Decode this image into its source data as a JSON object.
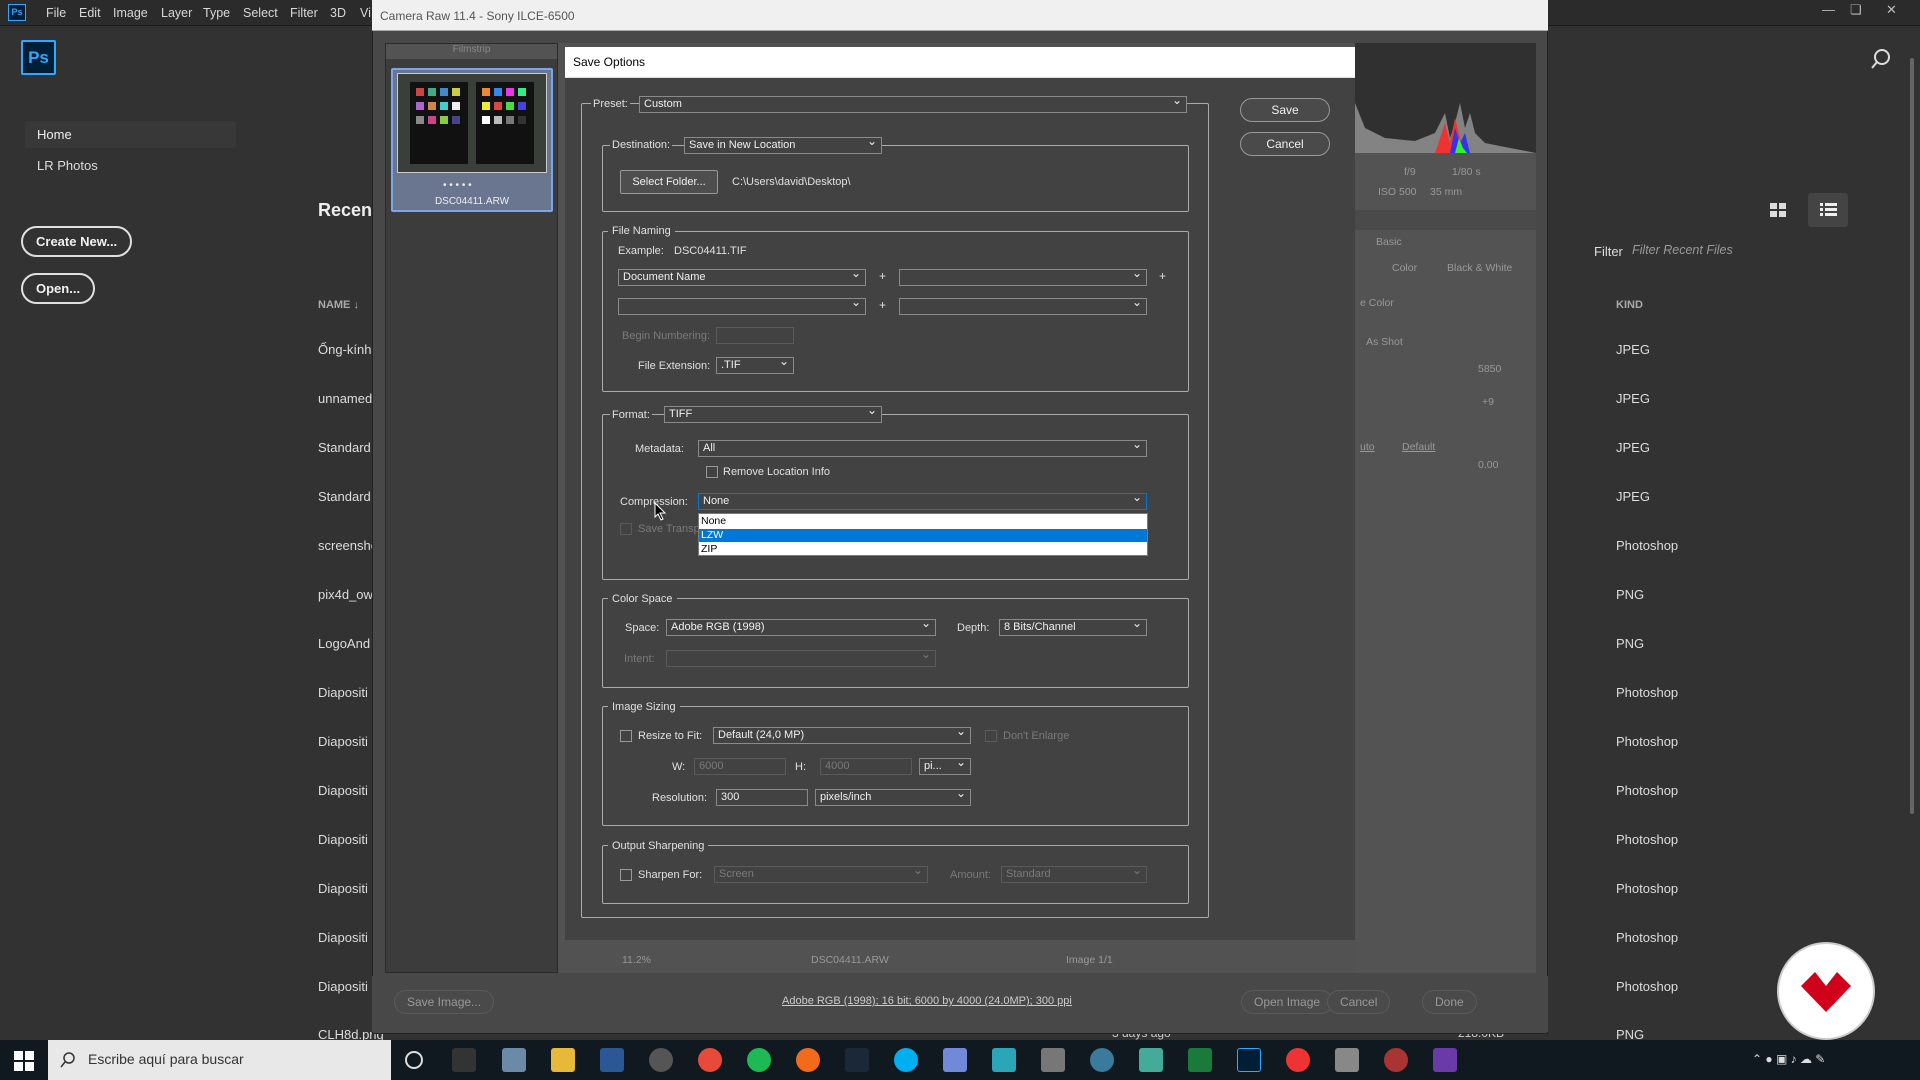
{
  "menubar": {
    "logo": "Ps",
    "items": [
      "File",
      "Edit",
      "Image",
      "Layer",
      "Type",
      "Select",
      "Filter",
      "3D",
      "Vi"
    ]
  },
  "home": {
    "logo": "Ps",
    "nav": {
      "home": "Home",
      "lr": "LR Photos"
    },
    "create_new": "Create New...",
    "open": "Open...",
    "recent_title": "Recent",
    "name_header": "NAME",
    "kind_header": "KIND",
    "filter_label": "Filter",
    "filter_placeholder": "Filter Recent Files",
    "files": [
      {
        "name": "Ống-kính",
        "kind": "JPEG"
      },
      {
        "name": "unnamed",
        "kind": "JPEG"
      },
      {
        "name": "Standard",
        "kind": "JPEG"
      },
      {
        "name": "Standard",
        "kind": "JPEG"
      },
      {
        "name": "screensho",
        "kind": "Photoshop"
      },
      {
        "name": "pix4d_ow",
        "kind": "PNG"
      },
      {
        "name": "LogoAnd",
        "kind": "PNG"
      },
      {
        "name": "Diapositi",
        "kind": "Photoshop"
      },
      {
        "name": "Diapositi",
        "kind": "Photoshop"
      },
      {
        "name": "Diapositi",
        "kind": "Photoshop"
      },
      {
        "name": "Diapositi",
        "kind": "Photoshop"
      },
      {
        "name": "Diapositi",
        "kind": "Photoshop"
      },
      {
        "name": "Diapositi",
        "kind": "Photoshop"
      },
      {
        "name": "Diapositi",
        "kind": "Photoshop"
      },
      {
        "name": "CLH8d.png",
        "kind": "PNG"
      }
    ],
    "last_time": "3 days ago",
    "last_size": "218.0KB"
  },
  "camera_raw": {
    "title": "Camera Raw 11.4  -  Sony ILCE-6500",
    "filmstrip_label": "Filmstrip",
    "thumb_label": "DSC04411.ARW",
    "exif_aperture": "f/9",
    "exif_shutter": "1/80 s",
    "exif_iso": "ISO 500",
    "exif_focal": "35 mm",
    "panel_title": "Basic",
    "color": "Color",
    "bw": "Black & White",
    "profile": "e Color",
    "wb": "As Shot",
    "temp": "5850",
    "tint": "+9",
    "auto": "uto",
    "default": "Default",
    "zero_val": "0.00",
    "zoom": "11.2%",
    "file_name": "DSC04411.ARW",
    "image_count": "Image 1/1",
    "save_image": "Save Image...",
    "info_link": "Adobe RGB (1998); 16 bit; 6000 by 4000 (24.0MP); 300 ppi",
    "open_image": "Open Image",
    "cancel": "Cancel",
    "done": "Done"
  },
  "save_options": {
    "title": "Save Options",
    "preset_label": "Preset:",
    "preset_value": "Custom",
    "save_button": "Save",
    "cancel_button": "Cancel",
    "destination_label": "Destination:",
    "destination_value": "Save in New Location",
    "select_folder": "Select Folder...",
    "folder_path": "C:\\Users\\david\\Desktop\\",
    "file_naming_title": "File Naming",
    "example_label": "Example:",
    "example_value": "DSC04411.TIF",
    "naming_field1": "Document Name",
    "begin_numbering": "Begin Numbering:",
    "file_extension_label": "File Extension:",
    "file_extension_value": ".TIF",
    "format_label": "Format:",
    "format_value": "TIFF",
    "metadata_label": "Metadata:",
    "metadata_value": "All",
    "remove_location": "Remove Location Info",
    "compression_label": "Compression:",
    "compression_value": "None",
    "compression_options": [
      "None",
      "LZW",
      "ZIP"
    ],
    "save_transparency": "Save Transp",
    "color_space_title": "Color Space",
    "space_label": "Space:",
    "space_value": "Adobe RGB (1998)",
    "depth_label": "Depth:",
    "depth_value": "8 Bits/Channel",
    "intent_label": "Intent:",
    "image_sizing_title": "Image Sizing",
    "resize_label": "Resize to Fit:",
    "resize_value": "Default  (24,0 MP)",
    "dont_enlarge": "Don't Enlarge",
    "w_label": "W:",
    "w_value": "6000",
    "h_label": "H:",
    "h_value": "4000",
    "unit_value": "pi...",
    "resolution_label": "Resolution:",
    "resolution_value": "300",
    "resolution_unit": "pixels/inch",
    "output_sharpening_title": "Output Sharpening",
    "sharpen_label": "Sharpen For:",
    "sharpen_value": "Screen",
    "amount_label": "Amount:",
    "amount_value": "Standard"
  },
  "taskbar": {
    "search_placeholder": "Escribe aquí para buscar"
  },
  "colors": {
    "ps_blue": "#31a8ff",
    "selection_blue": "#0078d7",
    "badge_red": "#d0021b"
  }
}
